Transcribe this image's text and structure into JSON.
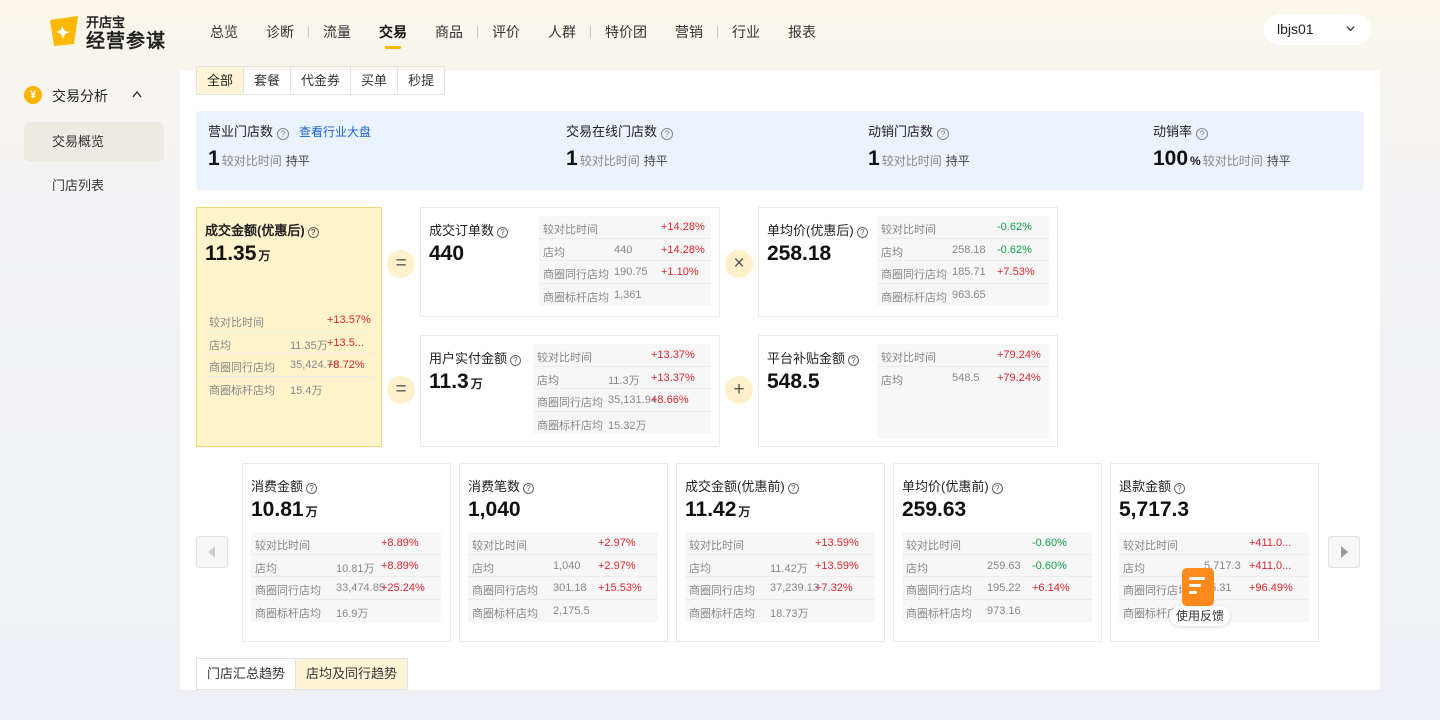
{
  "logo": {
    "line1": "开店宝",
    "line2": "经营参谋"
  },
  "nav": [
    "总览",
    "诊断",
    "流量",
    "交易",
    "商品",
    "评价",
    "人群",
    "特价团",
    "营销",
    "行业",
    "报表"
  ],
  "account": "lbjs01",
  "sidebar": {
    "section": "交易分析",
    "coin": "¥",
    "items": [
      "交易概览",
      "门店列表"
    ]
  },
  "tabs": [
    "全部",
    "套餐",
    "代金券",
    "买单",
    "秒提"
  ],
  "kpis": [
    {
      "title": "营业门店数",
      "link": "查看行业大盘",
      "value": "1",
      "unit": "",
      "cmp": "较对比时间",
      "flag": "持平"
    },
    {
      "title": "交易在线门店数",
      "value": "1",
      "unit": "",
      "cmp": "较对比时间",
      "flag": "持平"
    },
    {
      "title": "动销门店数",
      "value": "1",
      "unit": "",
      "cmp": "较对比时间",
      "flag": "持平"
    },
    {
      "title": "动销率",
      "value": "100",
      "unit": "%",
      "cmp": "较对比时间",
      "flag": "持平"
    }
  ],
  "ops": {
    "eq1": "=",
    "eq2": "=",
    "times": "×",
    "plus": "+"
  },
  "formula": {
    "gmv": {
      "title": "成交金额(优惠后)",
      "value": "11.35",
      "unit": "万",
      "rows": [
        [
          "较对比时间",
          "",
          "+13.57%"
        ],
        [
          "店均",
          "11.35万",
          "+13.5..."
        ],
        [
          "商圈同行店均",
          "35,424.78",
          "+8.72%"
        ],
        [
          "商圈标杆店均",
          "15.4万",
          ""
        ]
      ]
    },
    "orders": {
      "title": "成交订单数",
      "value": "440",
      "unit": "",
      "rows": [
        [
          "较对比时间",
          "",
          "+14.28%"
        ],
        [
          "店均",
          "440",
          "+14.28%"
        ],
        [
          "商圈同行店均",
          "190.75",
          "+1.10%"
        ],
        [
          "商圈标杆店均",
          "1,361",
          ""
        ]
      ]
    },
    "aov": {
      "title": "单均价(优惠后)",
      "value": "258.18",
      "unit": "",
      "rows": [
        [
          "较对比时间",
          "",
          "-0.62%"
        ],
        [
          "店均",
          "258.18",
          "-0.62%"
        ],
        [
          "商圈同行店均",
          "185.71",
          "+7.53%"
        ],
        [
          "商圈标杆店均",
          "963.65",
          ""
        ]
      ]
    },
    "paid": {
      "title": "用户实付金额",
      "value": "11.3",
      "unit": "万",
      "rows": [
        [
          "较对比时间",
          "",
          "+13.37%"
        ],
        [
          "店均",
          "11.3万",
          "+13.37%"
        ],
        [
          "商圈同行店均",
          "35,131.94",
          "+8.66%"
        ],
        [
          "商圈标杆店均",
          "15.32万",
          ""
        ]
      ]
    },
    "subsidy": {
      "title": "平台补贴金额",
      "value": "548.5",
      "unit": "",
      "rows": [
        [
          "较对比时间",
          "",
          "+79.24%"
        ],
        [
          "店均",
          "548.5",
          "+79.24%"
        ]
      ]
    }
  },
  "metrics": [
    {
      "title": "消费金额",
      "value": "10.81",
      "unit": "万",
      "rows": [
        [
          "较对比时间",
          "",
          "+8.89%"
        ],
        [
          "店均",
          "10.81万",
          "+8.89%"
        ],
        [
          "商圈同行店均",
          "33,474.85",
          "+25.24%"
        ],
        [
          "商圈标杆店均",
          "16.9万",
          ""
        ]
      ]
    },
    {
      "title": "消费笔数",
      "value": "1,040",
      "unit": "",
      "rows": [
        [
          "较对比时间",
          "",
          "+2.97%"
        ],
        [
          "店均",
          "1,040",
          "+2.97%"
        ],
        [
          "商圈同行店均",
          "301.18",
          "+15.53%"
        ],
        [
          "商圈标杆店均",
          "2,175.5",
          ""
        ]
      ]
    },
    {
      "title": "成交金额(优惠前)",
      "value": "11.42",
      "unit": "万",
      "rows": [
        [
          "较对比时间",
          "",
          "+13.59%"
        ],
        [
          "店均",
          "11.42万",
          "+13.59%"
        ],
        [
          "商圈同行店均",
          "37,239.13",
          "+7.32%"
        ],
        [
          "商圈标杆店均",
          "18.73万",
          ""
        ]
      ]
    },
    {
      "title": "单均价(优惠前)",
      "value": "259.63",
      "unit": "",
      "rows": [
        [
          "较对比时间",
          "",
          "-0.60%"
        ],
        [
          "店均",
          "259.63",
          "-0.60%"
        ],
        [
          "商圈同行店均",
          "195.22",
          "+6.14%"
        ],
        [
          "商圈标杆店均",
          "973.16",
          ""
        ]
      ]
    },
    {
      "title": "退款金额",
      "value": "5,717.3",
      "unit": "",
      "rows": [
        [
          "较对比时间",
          "",
          "+411.0..."
        ],
        [
          "店均",
          "5,717.3",
          "+411.0..."
        ],
        [
          "商圈同行店均",
          "15.31",
          "+96.49%"
        ],
        [
          "商圈标杆店均",
          "万",
          ""
        ]
      ]
    }
  ],
  "bottom_tabs": [
    "门店汇总趋势",
    "店均及同行趋势"
  ],
  "feedback": "使用反馈",
  "colors": {
    "accent": "#ffb800",
    "up": "#e0262f",
    "down": "#11a14a",
    "highlight": "#fff4cc"
  }
}
